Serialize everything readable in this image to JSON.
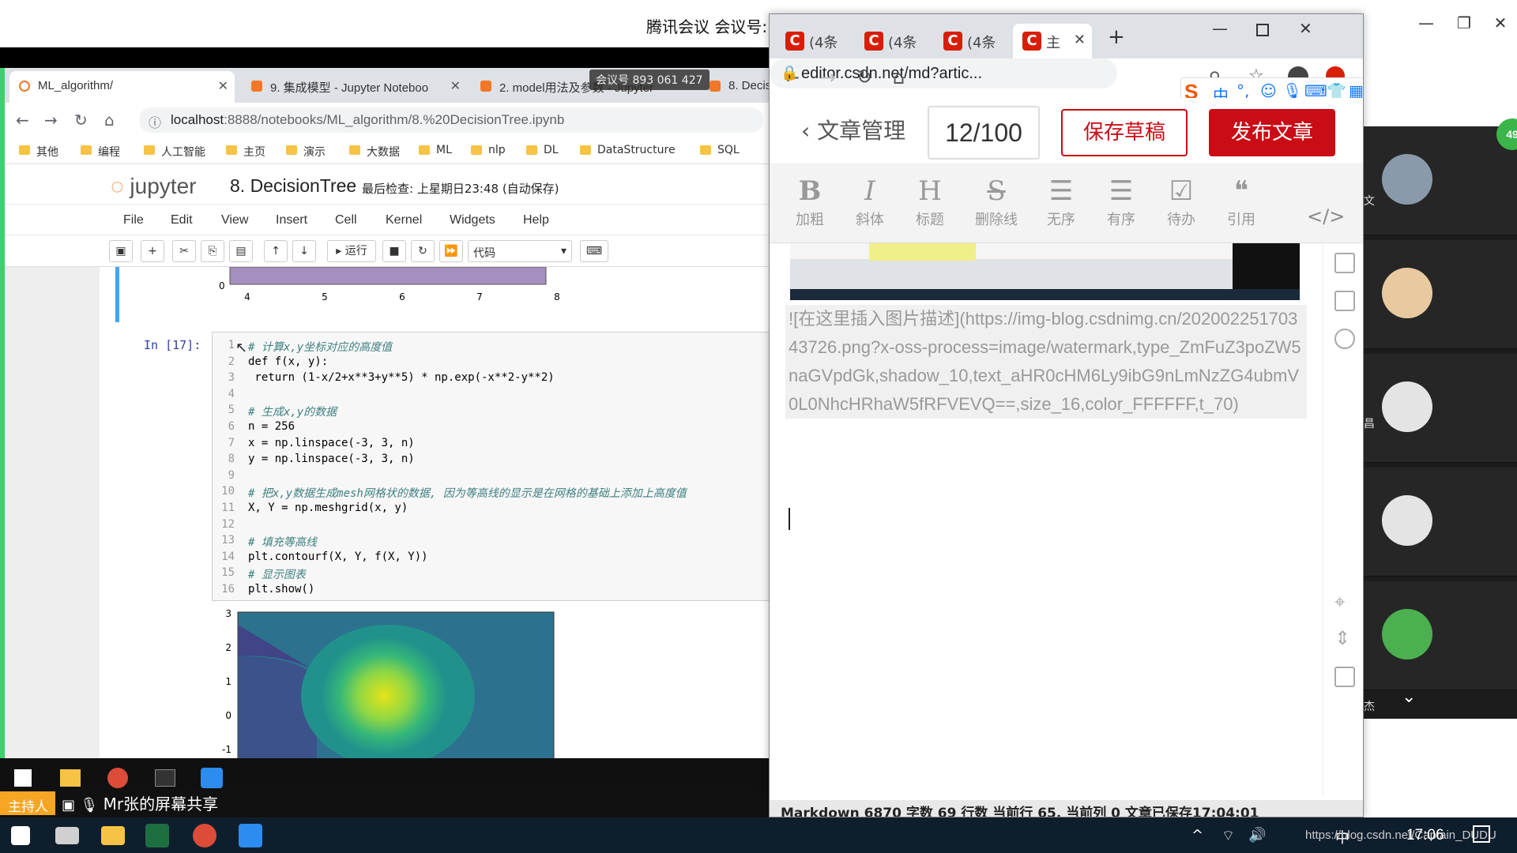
{
  "meeting": {
    "title": "腾讯会议 会议号:",
    "id_overlay": "会议号 893 061 427",
    "host_badge": "主持人",
    "share_label": "Mr张的屏幕共享",
    "participant_count": "49",
    "participant_labels": [
      "文",
      "昌",
      "杰"
    ]
  },
  "left_browser": {
    "tabs": [
      {
        "label": "ML_algorithm/",
        "active": true
      },
      {
        "label": "9. 集成模型 - Jupyter Noteboo"
      },
      {
        "label": "2. model用法及参数 - Jupyter"
      },
      {
        "label": "8. Decisi"
      }
    ],
    "url_host": "localhost",
    "url_path": ":8888/notebooks/ML_algorithm/8.%20DecisionTree.ipynb",
    "bookmarks": [
      "其他",
      "编程",
      "人工智能",
      "主页",
      "演示",
      "大数据",
      "ML",
      "nlp",
      "DL",
      "DataStructure",
      "SQL"
    ]
  },
  "jupyter": {
    "logo": "jupyter",
    "notebook_name": "8. DecisionTree",
    "save_status": "最后检查: 上星期日23:48  (自动保存)",
    "menu": [
      "File",
      "Edit",
      "View",
      "Insert",
      "Cell",
      "Kernel",
      "Widgets",
      "Help"
    ],
    "run_label": "运行",
    "cell_type": "代码",
    "prev_axis_ticks": [
      "4",
      "5",
      "6",
      "7",
      "8"
    ],
    "prev_y_zero": "0",
    "prompt": "In  [17]:",
    "code_lines": [
      {
        "n": "1",
        "t": "# 计算x,y坐标对应的高度值",
        "c": true
      },
      {
        "n": "2",
        "t": "def f(x, y):"
      },
      {
        "n": "3",
        "t": " return (1-x/2+x**3+y**5) * np.exp(-x**2-y**2)"
      },
      {
        "n": "4",
        "t": ""
      },
      {
        "n": "5",
        "t": "# 生成x,y的数据",
        "c": true
      },
      {
        "n": "6",
        "t": "n = 256"
      },
      {
        "n": "7",
        "t": "x = np.linspace(-3, 3, n)"
      },
      {
        "n": "8",
        "t": "y = np.linspace(-3, 3, n)"
      },
      {
        "n": "9",
        "t": ""
      },
      {
        "n": "10",
        "t": "# 把x,y数据生成mesh网格状的数据, 因为等高线的显示是在网格的基础上添加上高度值",
        "c": true
      },
      {
        "n": "11",
        "t": "X, Y = np.meshgrid(x, y)"
      },
      {
        "n": "12",
        "t": ""
      },
      {
        "n": "13",
        "t": "# 填充等高线",
        "c": true
      },
      {
        "n": "14",
        "t": "plt.contourf(X, Y, f(X, Y))"
      },
      {
        "n": "15",
        "t": "# 显示图表",
        "c": true
      },
      {
        "n": "16",
        "t": "plt.show()"
      }
    ],
    "plot_y_ticks": [
      "3",
      "2",
      "1",
      "0",
      "-1"
    ]
  },
  "csdn_browser": {
    "tabs": [
      {
        "label": "(4条"
      },
      {
        "label": "(4条"
      },
      {
        "label": "(4条"
      },
      {
        "label": "主",
        "active": true
      }
    ],
    "url": "editor.csdn.net/md?artic...",
    "back_label": "文章管理",
    "title_count": "12/100",
    "save_draft": "保存草稿",
    "publish": "发布文章",
    "format_tools": [
      {
        "glyph": "B",
        "label": "加粗"
      },
      {
        "glyph": "I",
        "label": "斜体"
      },
      {
        "glyph": "H",
        "label": "标题"
      },
      {
        "glyph": "S",
        "label": "删除线"
      },
      {
        "glyph": "☰",
        "label": "无序"
      },
      {
        "glyph": "☰",
        "label": "有序"
      },
      {
        "glyph": "☑",
        "label": "待办"
      },
      {
        "glyph": "❝",
        "label": "引用"
      }
    ],
    "code_tool": "</>",
    "markdown_text": "![在这里插入图片描述](https://img-blog.csdnimg.cn/20200225170343726.png?x-oss-process=image/watermark,type_ZmFuZ3poZW5naGVpdGk,shadow_10,text_aHR0cHM6Ly9ibG9nLmNzZG4ubmV0L0NhcHRhaW5fRFVEVQ==,size_16,color_FFFFFF,t_70)",
    "status_bar": "Markdown  6870 字数  69 行数  当前行 65, 当前列 0  文章已保存17:04:01",
    "ime_badge": "中"
  },
  "taskbar": {
    "clock": "17:06",
    "overlay_url": "https://blog.csdn.net/Captain_DUDU",
    "ime": "中"
  },
  "colors": {
    "csdn_red": "#ca0c16",
    "jupyter_orange": "#f37726",
    "share_green": "#3bd16f",
    "host_orange": "#f6a623"
  }
}
